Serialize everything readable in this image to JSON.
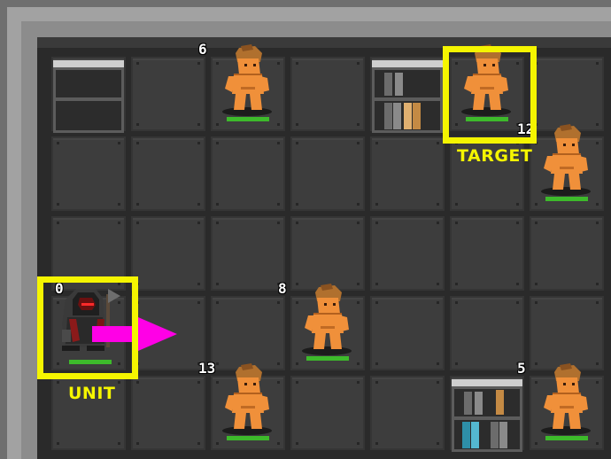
{
  "scene": {
    "grid_columns": 7,
    "grid_rows": 5
  },
  "entities": {
    "npcs": [
      {
        "id": "npc-6",
        "label": "6",
        "col": 2,
        "row": 0
      },
      {
        "id": "npc-target",
        "label": "",
        "col": 5,
        "row": 0
      },
      {
        "id": "npc-12",
        "label": "12",
        "col": 6,
        "row": 1
      },
      {
        "id": "npc-8",
        "label": "8",
        "col": 3,
        "row": 3
      },
      {
        "id": "npc-13",
        "label": "13",
        "col": 2,
        "row": 4
      },
      {
        "id": "npc-5",
        "label": "5",
        "col": 6,
        "row": 4
      }
    ],
    "unit": {
      "label": "0",
      "col": 0,
      "row": 3
    },
    "bookshelves": [
      {
        "id": "shelf-a",
        "col": 0,
        "row": 0,
        "variant": "empty"
      },
      {
        "id": "shelf-b",
        "col": 4,
        "row": 0,
        "variant": "books"
      },
      {
        "id": "shelf-c",
        "col": 5,
        "row": 4,
        "variant": "books-blue"
      }
    ]
  },
  "annotations": {
    "target_caption": "TARGET",
    "unit_caption": "UNIT",
    "arrow_direction": "right"
  },
  "colors": {
    "highlight": "#f5f500",
    "arrow": "#ff00e6",
    "hp_bar": "#3dba2b",
    "skin": "#f0903a",
    "hair": "#b0702e"
  }
}
